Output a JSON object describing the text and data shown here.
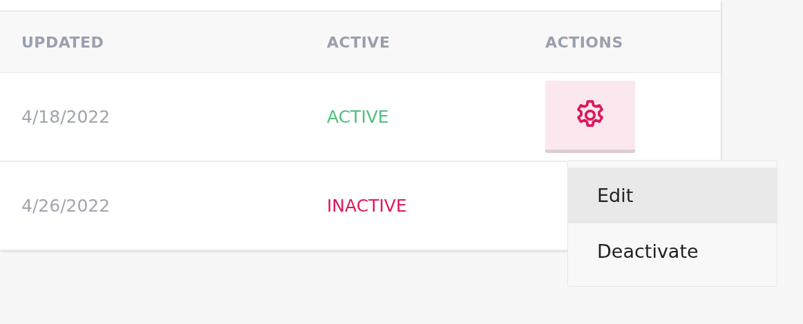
{
  "table": {
    "columns": [
      "UPDATED",
      "ACTIVE",
      "ACTIONS"
    ],
    "rows": [
      {
        "updated": "4/18/2022",
        "status": {
          "label": "ACTIVE",
          "active": true
        },
        "has_action_button": true
      },
      {
        "updated": "4/26/2022",
        "status": {
          "label": "INACTIVE",
          "active": false
        },
        "has_action_button": false
      }
    ]
  },
  "action_menu": {
    "items": [
      {
        "label": "Edit",
        "selected": true
      },
      {
        "label": "Deactivate",
        "selected": false
      }
    ]
  }
}
